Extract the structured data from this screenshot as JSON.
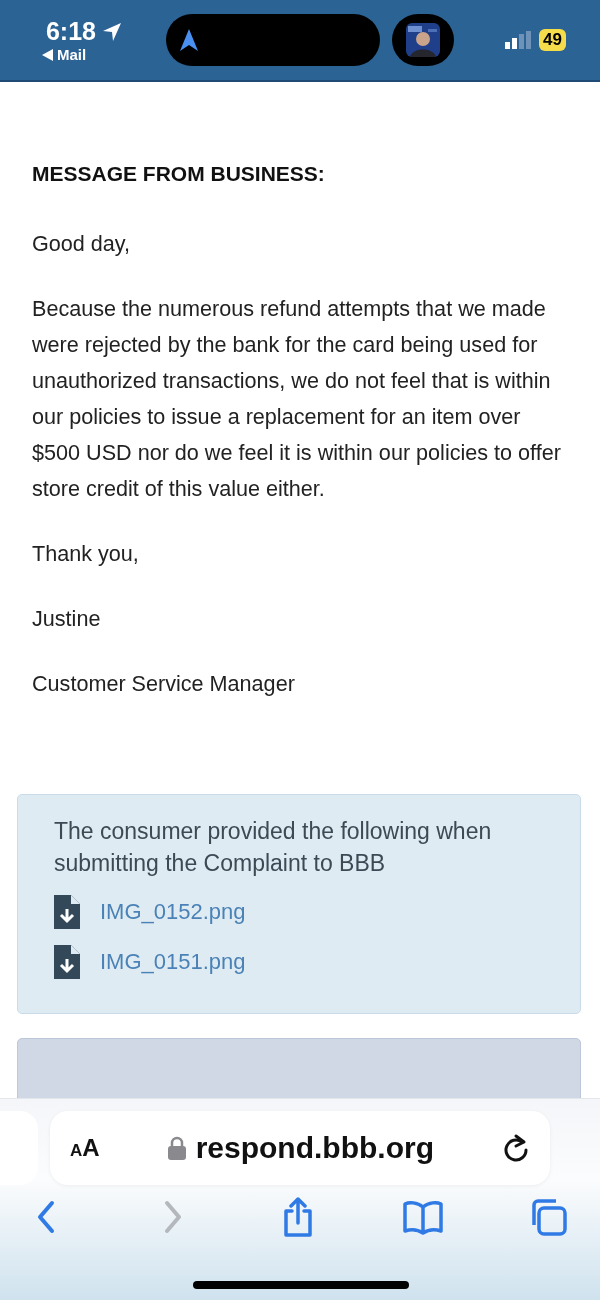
{
  "status_bar": {
    "time": "6:18",
    "back_app": "Mail",
    "battery": "49"
  },
  "message": {
    "heading": "MESSAGE FROM BUSINESS:",
    "paragraphs": [
      "Good day,",
      "Because the numerous refund attempts that we made were rejected by the bank for the card being used for unauthorized transactions, we do not feel that is within our policies to issue a replacement for an item over $500 USD nor do we feel it is within our policies to offer store credit of this value either.",
      "Thank you,",
      "Justine",
      "Customer Service Manager"
    ]
  },
  "attachments": {
    "title": "The consumer provided the following when submitting the Complaint to BBB",
    "files": [
      "IMG_0152.png",
      "IMG_0151.png"
    ]
  },
  "browser": {
    "text_size_label": "AA",
    "url": "respond.bbb.org",
    "toolbar": [
      {
        "kind": "back",
        "disabled": false
      },
      {
        "kind": "forward",
        "disabled": true
      },
      {
        "kind": "share",
        "disabled": false
      },
      {
        "kind": "bookmarks",
        "disabled": false
      },
      {
        "kind": "tabs",
        "disabled": false
      }
    ]
  }
}
